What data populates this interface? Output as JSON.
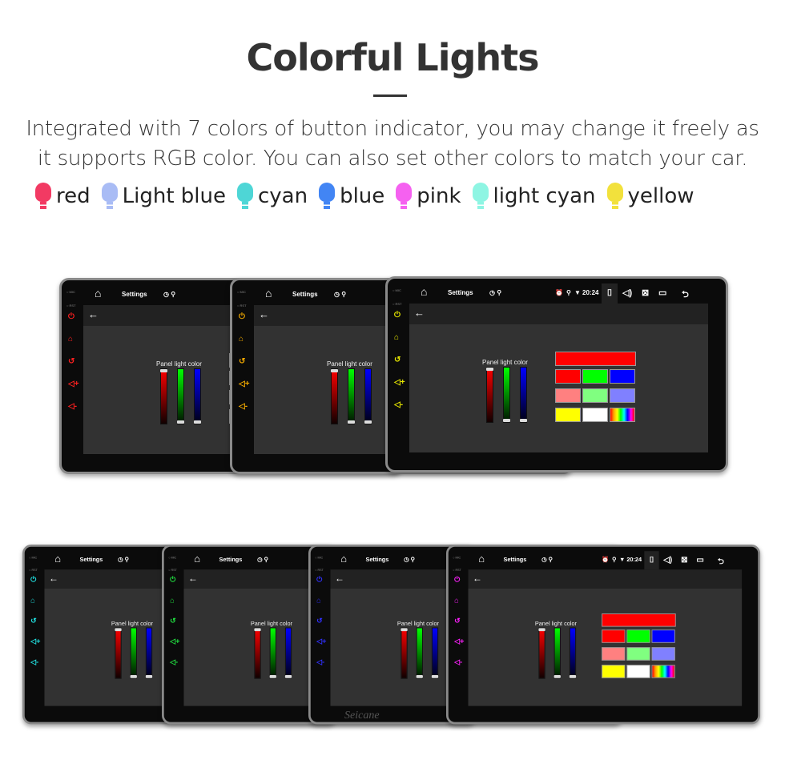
{
  "title": "Colorful Lights",
  "description": [
    "Integrated with 7 colors of button indicator, you may change it freely as",
    "it supports RGB color. You can also set other colors to match your car."
  ],
  "legend": [
    {
      "label": "red",
      "color": "#f23a63"
    },
    {
      "label": "Light blue",
      "color": "#a9bcf5"
    },
    {
      "label": "cyan",
      "color": "#4ed6d6"
    },
    {
      "label": "blue",
      "color": "#4285f4"
    },
    {
      "label": "pink",
      "color": "#f561f0"
    },
    {
      "label": "light cyan",
      "color": "#8ef5e3"
    },
    {
      "label": "yellow",
      "color": "#f2e13c"
    }
  ],
  "device": {
    "mic_label": "MIC",
    "rst_label": "RST",
    "app_title": "Settings",
    "clock": "20:24",
    "panel_label": "Panel light color",
    "brand": "Seicane",
    "swatch_top": "#ff0000",
    "swatches": [
      "#ff0000",
      "#00ff00",
      "#0000ff",
      "#ff8080",
      "#80ff80",
      "#8080ff",
      "#ffff00",
      "#ffffff",
      "rainbow"
    ],
    "icons": [
      "home-icon",
      "timer-icon",
      "usb-icon",
      "alarm-icon",
      "location-icon",
      "wifi-icon",
      "camera-icon",
      "volume-icon",
      "close-window-icon",
      "multiwindow-icon",
      "back-icon",
      "power-icon",
      "home-button-icon",
      "return-icon",
      "volume-up-icon",
      "volume-down-icon",
      "arrow-left-icon"
    ]
  },
  "screens": [
    {
      "button_color": "#ff2020"
    },
    {
      "button_color": "#f0a800"
    },
    {
      "button_color": "#e8e800"
    },
    {
      "button_color": "#20e0e0"
    },
    {
      "button_color": "#20e040"
    },
    {
      "button_color": "#3030ff"
    },
    {
      "button_color": "#ff20ff"
    }
  ]
}
